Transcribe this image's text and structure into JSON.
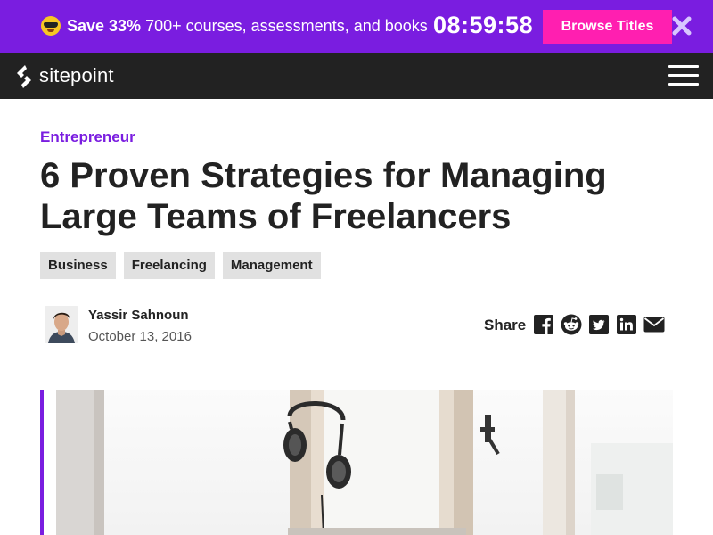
{
  "promo": {
    "save_label": "Save 33%",
    "description": " 700+ courses, assessments, and books",
    "timer": "08:59:58",
    "button_label": "Browse Titles",
    "emoji_icon": "sunglasses-face-icon",
    "close_icon": "close-icon"
  },
  "header": {
    "logo_text": "sitepoint",
    "menu_icon": "hamburger-menu-icon"
  },
  "article": {
    "category": "Entrepreneur",
    "title": "6 Proven Strategies for Managing Large Teams of Freelancers",
    "tags": [
      "Business",
      "Freelancing",
      "Management"
    ],
    "author": {
      "name": "Yassir Sahnoun",
      "date": "October 13, 2016"
    },
    "share": {
      "label": "Share",
      "icons": [
        "facebook-icon",
        "reddit-icon",
        "twitter-icon",
        "linkedin-icon",
        "email-icon"
      ]
    }
  },
  "colors": {
    "promo_bg": "#7a1de0",
    "promo_button": "#ff1fb0",
    "header_bg": "#222222",
    "accent": "#7a1de0",
    "tag_bg": "#e1e1e1"
  }
}
